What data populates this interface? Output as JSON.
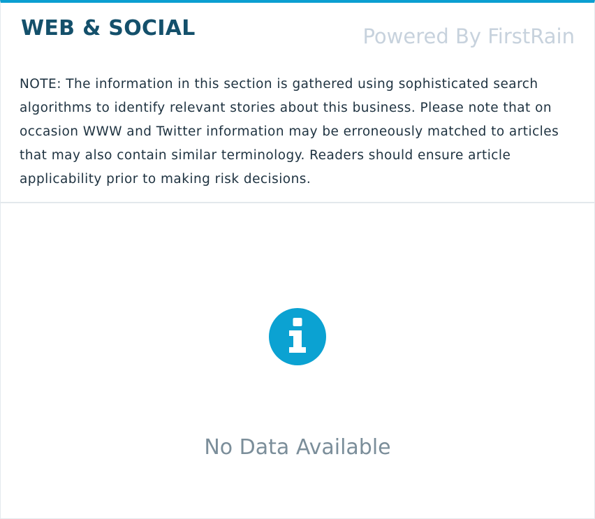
{
  "section": {
    "title": "WEB & SOCIAL",
    "powered_by": "Powered By FirstRain",
    "note": "NOTE: The information in this section is gathered using sophisticated search algorithms to identify relevant stories about this business. Please note that on occasion WWW and Twitter information may be erroneously matched to articles that may also contain similar terminology. Readers should ensure article applicability prior to making risk decisions."
  },
  "empty_state": {
    "icon": "info-icon",
    "message": "No Data Available"
  },
  "colors": {
    "accent": "#0b9fd1",
    "title": "#14506b",
    "powered_by": "#c7d2dd",
    "note_text": "#1e3240",
    "empty_text": "#7b8e9a"
  }
}
